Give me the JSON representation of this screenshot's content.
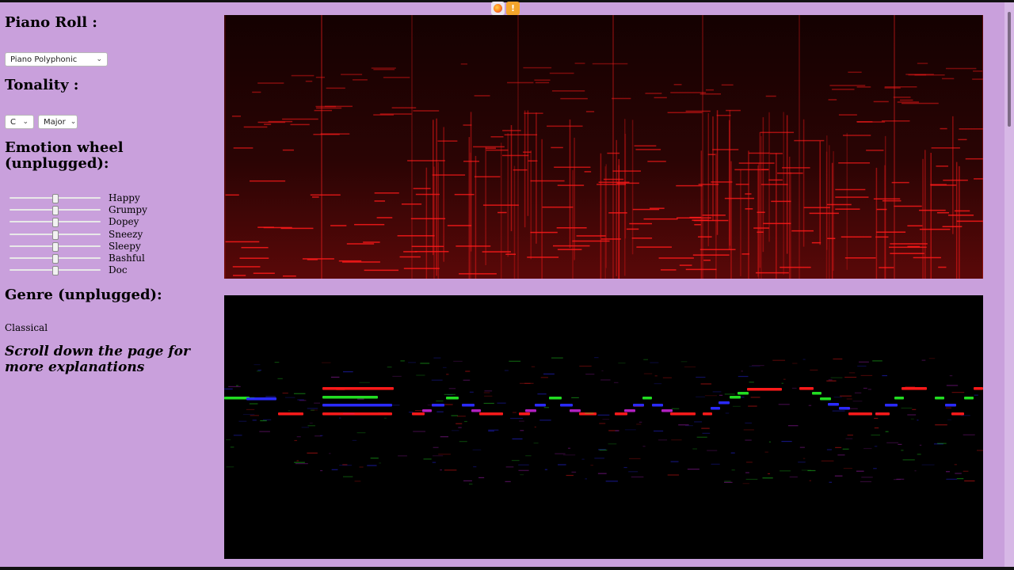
{
  "browser": {
    "icons": [
      "firefox-icon",
      "warning-icon"
    ]
  },
  "sidebar": {
    "piano_roll_title": "Piano Roll :",
    "instrument_select": "Piano Polyphonic",
    "tonality_title": "Tonality :",
    "key_select": "C",
    "mode_select": "Major",
    "emotion_title": "Emotion wheel (unplugged):",
    "emotions": [
      {
        "label": "Happy",
        "value": 0.5
      },
      {
        "label": "Grumpy",
        "value": 0.5
      },
      {
        "label": "Dopey",
        "value": 0.5
      },
      {
        "label": "Sneezy",
        "value": 0.5
      },
      {
        "label": "Sleepy",
        "value": 0.5
      },
      {
        "label": "Bashful",
        "value": 0.5
      },
      {
        "label": "Doc",
        "value": 0.5
      }
    ],
    "genre_title": "Genre (unplugged):",
    "genre_value": "Classical",
    "scroll_note": "Scroll down the page for more explanations"
  },
  "colors": {
    "background": "#c9a0dc",
    "spectrogram": "#e01010",
    "note_red": "#ff1a1a",
    "note_green": "#22dd22",
    "note_blue": "#2a2aff",
    "note_purple": "#b020c0"
  }
}
